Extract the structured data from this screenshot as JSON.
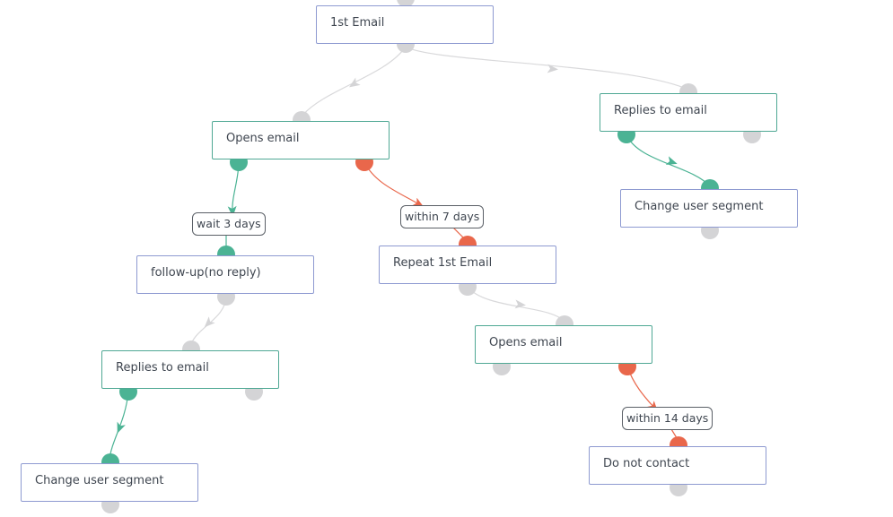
{
  "colors": {
    "action_border": "#8e9ad1",
    "trigger_border": "#4fa894",
    "default_edge": "#d9d9db",
    "yes_edge": "#4bb394",
    "no_edge": "#e9674b",
    "port_default": "#d4d4d6"
  },
  "nodes": [
    {
      "id": "first-email",
      "label": "1st Email",
      "kind": "action"
    },
    {
      "id": "opens-email-1",
      "label": "Opens email",
      "kind": "trigger"
    },
    {
      "id": "replies-email-1",
      "label": "Replies to email",
      "kind": "trigger"
    },
    {
      "id": "change-segment-1",
      "label": "Change user segment",
      "kind": "action"
    },
    {
      "id": "follow-up",
      "label": "follow-up(no reply)",
      "kind": "action"
    },
    {
      "id": "repeat-first-email",
      "label": "Repeat 1st Email",
      "kind": "action"
    },
    {
      "id": "opens-email-2",
      "label": "Opens email",
      "kind": "trigger"
    },
    {
      "id": "replies-email-2",
      "label": "Replies to email",
      "kind": "trigger"
    },
    {
      "id": "change-segment-2",
      "label": "Change user segment",
      "kind": "action"
    },
    {
      "id": "do-not-contact",
      "label": "Do not contact",
      "kind": "action"
    }
  ],
  "edge_labels": [
    {
      "id": "wait-3-days",
      "text": "wait 3 days"
    },
    {
      "id": "within-7-days",
      "text": "within 7 days"
    },
    {
      "id": "within-14-days",
      "text": "within 14 days"
    }
  ],
  "edges": [
    {
      "from": "first-email",
      "to": "opens-email-1",
      "type": "default"
    },
    {
      "from": "first-email",
      "to": "replies-email-1",
      "type": "default"
    },
    {
      "from": "replies-email-1",
      "to": "change-segment-1",
      "type": "yes"
    },
    {
      "from": "opens-email-1",
      "to": "follow-up",
      "type": "yes",
      "label": "wait 3 days"
    },
    {
      "from": "opens-email-1",
      "to": "repeat-first-email",
      "type": "no",
      "label": "within 7 days"
    },
    {
      "from": "follow-up",
      "to": "replies-email-2",
      "type": "default"
    },
    {
      "from": "replies-email-2",
      "to": "change-segment-2",
      "type": "yes"
    },
    {
      "from": "repeat-first-email",
      "to": "opens-email-2",
      "type": "default"
    },
    {
      "from": "opens-email-2",
      "to": "do-not-contact",
      "type": "no",
      "label": "within 14 days"
    }
  ]
}
